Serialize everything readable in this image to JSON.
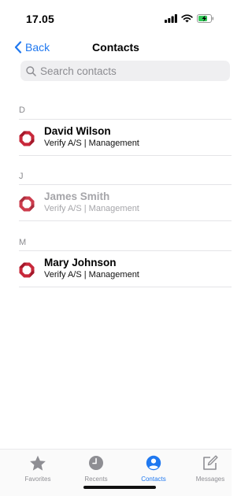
{
  "status_bar": {
    "time": "17.05"
  },
  "nav": {
    "back_label": "Back",
    "title": "Contacts"
  },
  "search": {
    "placeholder": "Search contacts"
  },
  "sections": [
    {
      "letter": "D",
      "contacts": [
        {
          "name": "David Wilson",
          "subtitle": "Verify A/S | Management",
          "dimmed": false
        }
      ]
    },
    {
      "letter": "J",
      "contacts": [
        {
          "name": "James Smith",
          "subtitle": "Verify A/S | Management",
          "dimmed": true
        }
      ]
    },
    {
      "letter": "M",
      "contacts": [
        {
          "name": "Mary Johnson",
          "subtitle": "Verify A/S | Management",
          "dimmed": false
        }
      ]
    }
  ],
  "tabs": [
    {
      "label": "Favorites",
      "icon": "star-icon",
      "active": false
    },
    {
      "label": "Recents",
      "icon": "clock-icon",
      "active": false
    },
    {
      "label": "Contacts",
      "icon": "person-circle-icon",
      "active": true
    },
    {
      "label": "Messages",
      "icon": "compose-icon",
      "active": false
    }
  ],
  "colors": {
    "accent": "#1f78f0",
    "logo_red": "#c8283a",
    "inactive": "#8e8e93"
  }
}
